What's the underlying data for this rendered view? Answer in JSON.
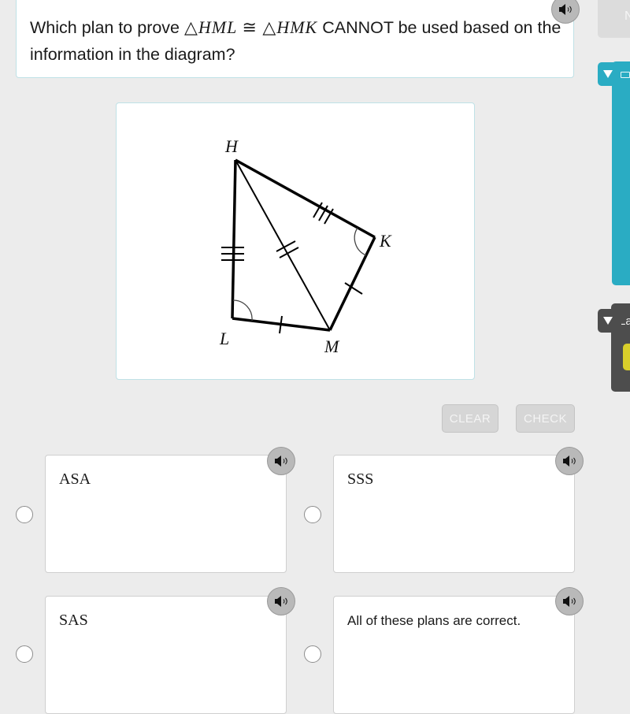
{
  "question": {
    "text_before": "Which plan to prove ",
    "math_left": "HML",
    "congruent_symbol": "≅",
    "triangle_symbol": "△",
    "math_right": "HMK",
    "text_after": " CANNOT be used based on the information in the diagram?",
    "audio_icon": "speaker-icon"
  },
  "side_tools": {
    "next_label": "N",
    "teal_panel_icon": "calculator-icon",
    "dark_panel_label": "La"
  },
  "diagram": {
    "vertices": {
      "H": "H",
      "K": "K",
      "L": "L",
      "M": "M"
    },
    "markings": {
      "HL_ticks": 3,
      "HK_ticks": 3,
      "HM_ticks": 2,
      "LM_ticks": 1,
      "KM_ticks": 1,
      "angle_L_arc": 1,
      "angle_K_arc": 1
    }
  },
  "actions": {
    "clear_label": "CLEAR",
    "check_label": "CHECK"
  },
  "choices": [
    {
      "label": "ASA",
      "selected": false
    },
    {
      "label": "SSS",
      "selected": false
    },
    {
      "label": "SAS",
      "selected": false
    },
    {
      "label": "All of these plans are correct.",
      "selected": false
    }
  ]
}
